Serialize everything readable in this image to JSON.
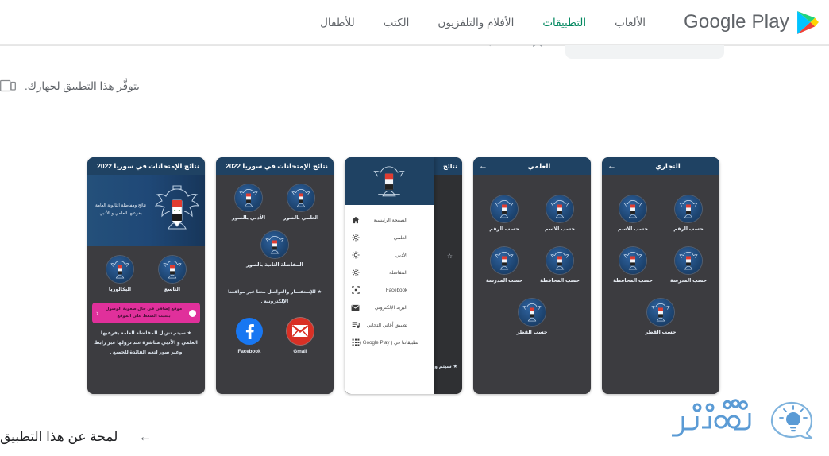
{
  "header": {
    "logo_text": "Google Play",
    "logo_icon": "google-play-triangle-icon",
    "nav": [
      {
        "label": "الألعاب",
        "active": false
      },
      {
        "label": "التطبيقات",
        "active": true
      },
      {
        "label": "الأفلام والتلفزيون",
        "active": false
      },
      {
        "label": "الكتب",
        "active": false
      },
      {
        "label": "للأطفال",
        "active": false
      }
    ],
    "accent_color": "#01875f"
  },
  "availability": {
    "text": "يتوفَّر هذا التطبيق لجهازك.",
    "icon": "device-tablet-icon"
  },
  "screenshots": [
    {
      "id": "shot-home",
      "title": "نتائج الإمتحانات في سوريا 2022",
      "nav_icon": "hamburger-menu-icon",
      "hero_text": "نتائج ومفاضلة الثانوية العامة بفرعيها العلمي و الأدبي",
      "tiles": [
        {
          "label": "البكالوريا"
        },
        {
          "label": "التاسع"
        }
      ],
      "promo_text": "موقع إضافي في حال صعوبة الوصول بسبب الضغط على الموقع",
      "promo_color": "#e0309b",
      "note": "★ سيتم تنزيل المفاضلة العامة بفرعيها العلمي و الأدبي مباشرة عند نزولها عبر رابط وعبر صور لتعم الفائدة للجميع ."
    },
    {
      "id": "shot-photos",
      "title": "نتائج الإمتحانات في سوريا 2022",
      "nav_icon": "hamburger-menu-icon",
      "tiles": [
        {
          "label": "الأدبي بالصور"
        },
        {
          "label": "العلمي بالصور"
        },
        {
          "label": "المفاضلة الثانية بالصور"
        }
      ],
      "note": "★ للإستفسار والتواصل معنا عبر مواقعنا الإلكترونية .",
      "social": [
        {
          "label": "Gmail",
          "icon": "gmail-icon",
          "color": "#d93025"
        },
        {
          "label": "Facebook",
          "icon": "facebook-icon",
          "color": "#1877f2"
        }
      ]
    },
    {
      "id": "shot-drawer",
      "background_title": "نتائج",
      "drawer_header_icon": "syria-eagle-emblem-icon",
      "drawer_items": [
        {
          "label": "الصفحة الرئيسية",
          "icon": "home-icon"
        },
        {
          "label": "العلمي",
          "icon": "settings-gear-icon"
        },
        {
          "label": "الأدبي",
          "icon": "settings-gear-icon"
        },
        {
          "label": "المفاضلة",
          "icon": "settings-gear-icon"
        },
        {
          "label": "Facebook",
          "icon": "facebook-outline-icon"
        },
        {
          "label": "البريد الإلكتروني",
          "icon": "mail-icon"
        },
        {
          "label": "تطبيق أغاني التجاني",
          "icon": "playlist-icon"
        },
        {
          "label": "تطبيقاتنا في ( Google Play )",
          "icon": "apps-grid-icon"
        }
      ],
      "peek_star": "☆",
      "peek_text": "★ سيتم\nو الأدبي"
    },
    {
      "id": "shot-scientific",
      "title": "العلمي",
      "nav_icon": "back-arrow-icon",
      "tiles": [
        {
          "label": "حسب الرقم"
        },
        {
          "label": "حسب الاسم"
        },
        {
          "label": "حسب المدرسة"
        },
        {
          "label": "حسب المحافظة"
        },
        {
          "label": "حسب القطر"
        }
      ]
    },
    {
      "id": "shot-commercial",
      "title": "التجاري",
      "nav_icon": "back-arrow-icon",
      "tiles": [
        {
          "label": "حسب الاسم"
        },
        {
          "label": "حسب الرقم"
        },
        {
          "label": "حسب المحافظة"
        },
        {
          "label": "حسب المدرسة"
        },
        {
          "label": "حسب القطر"
        }
      ]
    }
  ],
  "about": {
    "title": "لمحة عن هذا التطبيق",
    "arrow": "←",
    "arrow_icon": "left-arrow-icon"
  },
  "watermark": {
    "text": "ثقفني",
    "icon": "lightbulb-speech-bubble-icon",
    "color": "#5b9bd5"
  }
}
